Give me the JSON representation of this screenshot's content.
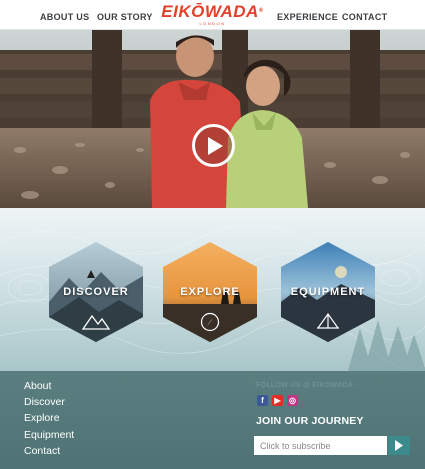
{
  "nav": {
    "items": [
      {
        "label": "ABOUT US"
      },
      {
        "label": "OUR STORY"
      },
      {
        "label": "EXPERIENCE"
      },
      {
        "label": "CONTACT"
      }
    ],
    "logo": {
      "name": "EIKŌWADA",
      "tagline": "LONDON"
    }
  },
  "hero": {
    "play_icon": "play-icon",
    "slides": 4,
    "active_slide": 1
  },
  "features": [
    {
      "label": "DISCOVER",
      "icon": "mountain-icon"
    },
    {
      "label": "EXPLORE",
      "icon": "compass-icon"
    },
    {
      "label": "EQUIPMENT",
      "icon": "tent-icon"
    }
  ],
  "footer": {
    "links": [
      "About",
      "Discover",
      "Explore",
      "Equipment",
      "Contact"
    ],
    "follow_label": "FOLLOW US @ EIKOWADA",
    "social": [
      {
        "icon": "facebook-icon",
        "color": "#3b5998"
      },
      {
        "icon": "youtube-icon",
        "color": "#e52d27"
      },
      {
        "icon": "instagram-icon",
        "color": "#c13584"
      }
    ],
    "join_label": "JOIN OUR JOURNEY",
    "subscribe_placeholder": "Click to subscribe"
  },
  "colors": {
    "brand_red": "#e3402b",
    "footer_teal": "#4f7374",
    "button_teal": "#3c8a8c"
  }
}
